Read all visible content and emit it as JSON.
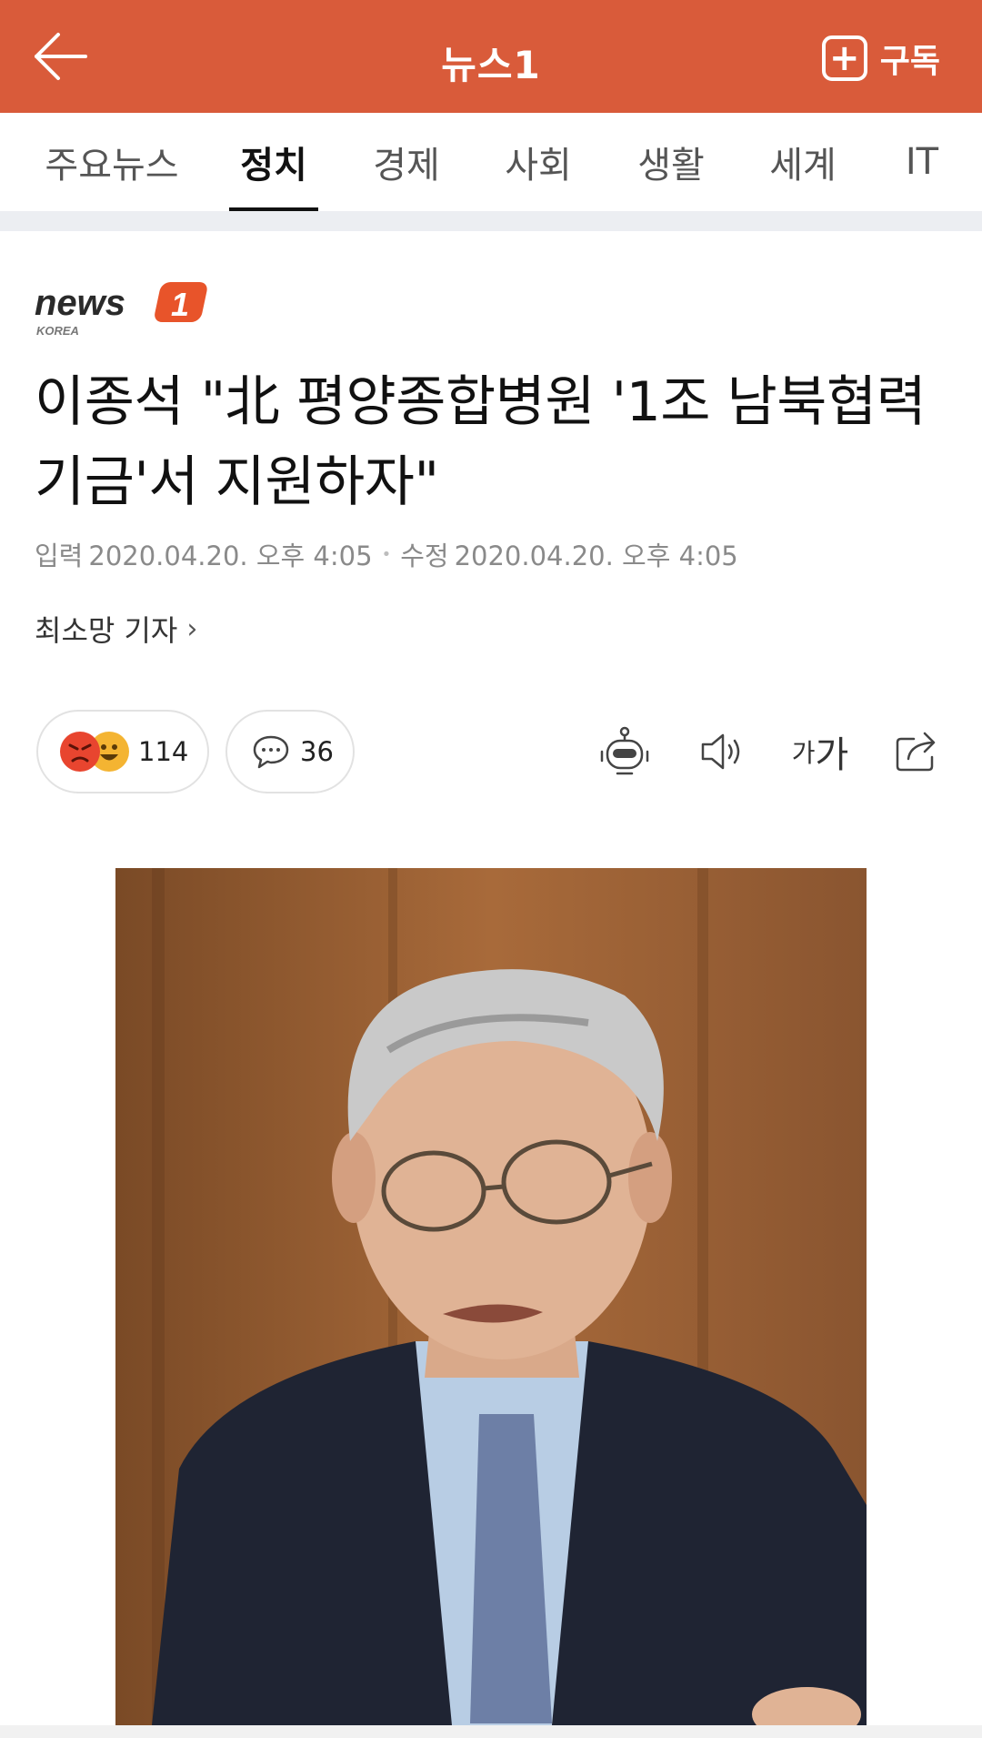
{
  "app": {
    "title": "뉴스1",
    "subscribe_label": "구독",
    "subscribe_plus": "+",
    "back_icon": "arrow-left-icon"
  },
  "tabs": [
    {
      "label": "주요뉴스",
      "active": false
    },
    {
      "label": "정치",
      "active": true
    },
    {
      "label": "경제",
      "active": false
    },
    {
      "label": "사회",
      "active": false
    },
    {
      "label": "생활",
      "active": false
    },
    {
      "label": "세계",
      "active": false
    },
    {
      "label": "IT",
      "active": false
    }
  ],
  "article": {
    "source_logo": "news 1 KOREA",
    "headline": "이종석 \"北 평양종합병원 '1조 남북협력기금'서 지원하자\"",
    "published_label": "입력",
    "published": "2020.04.20. 오후 4:05",
    "modified_label": "수정",
    "modified": "2020.04.20. 오후 4:05",
    "reporter": "최소망 기자",
    "reaction_count": "114",
    "comment_count": "36",
    "font_size_label_small": "가",
    "font_size_label_big": "가"
  },
  "colors": {
    "brand": "#d95b3a",
    "tab_active": "#111111",
    "meta_text": "#8a8a8a"
  }
}
